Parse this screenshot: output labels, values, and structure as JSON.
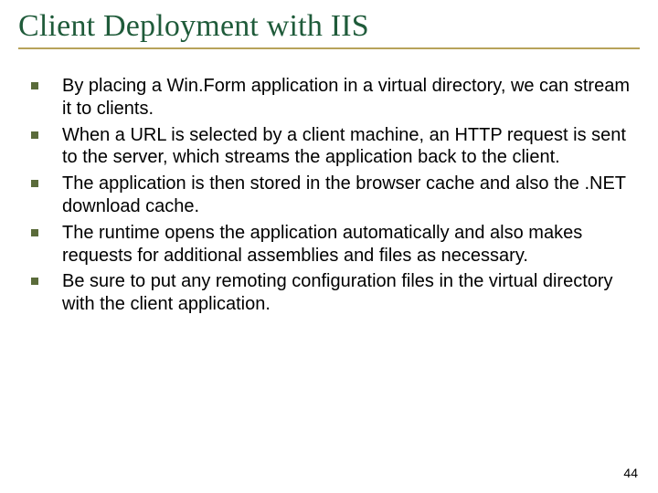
{
  "title": "Client Deployment with IIS",
  "bullets": [
    "By placing a Win.Form application in a virtual directory, we can stream it to clients.",
    "When a URL is selected by a client machine, an HTTP request is sent to the server, which streams the application back to the client.",
    "The application is then stored in the browser cache and also the .NET download cache.",
    "The runtime opens the application automatically and also makes requests for additional assemblies and files as necessary.",
    "Be sure to put any remoting configuration files in the virtual directory with the client application."
  ],
  "page_number": "44",
  "colors": {
    "title": "#1f5b3a",
    "rule": "#b7a25a",
    "bullet": "#5a6b3a"
  }
}
